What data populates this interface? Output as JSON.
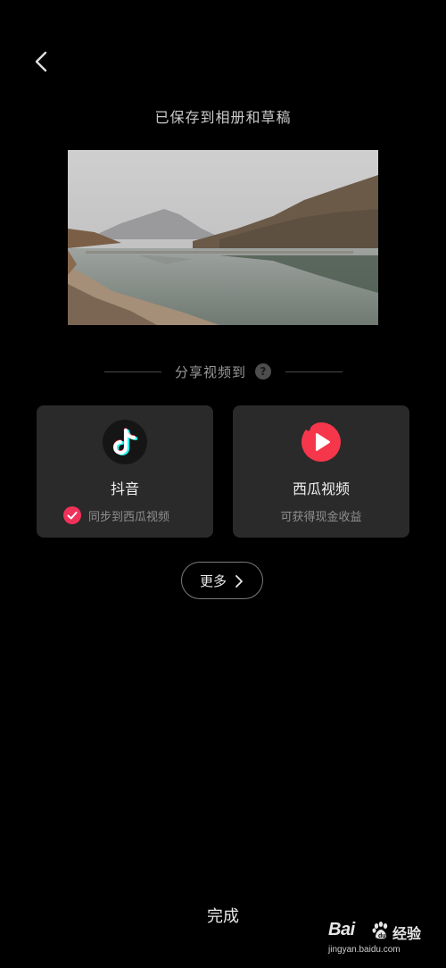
{
  "header": {
    "back_icon": "chevron-left-icon",
    "saved_message": "已保存到相册和草稿"
  },
  "preview": {
    "description_icon": "landscape-thumbnail"
  },
  "share": {
    "label": "分享视频到",
    "help_icon": "question-mark-icon",
    "help_glyph": "?"
  },
  "platforms": {
    "douyin": {
      "name": "抖音",
      "icon": "tiktok-logo-icon",
      "sync_label": "同步到西瓜视频",
      "sync_checked": true,
      "accent": "#f0325a"
    },
    "xigua": {
      "name": "西瓜视频",
      "icon": "xigua-logo-icon",
      "subtitle": "可获得现金收益",
      "accent": "#f5364b"
    }
  },
  "more": {
    "label": "更多",
    "icon": "chevron-right-icon"
  },
  "footer": {
    "done_label": "完成"
  },
  "watermark": {
    "brand": "Bai",
    "brand_tail": "du",
    "cn": "经验",
    "url": "jingyan.baidu.com"
  },
  "colors": {
    "background": "#000000",
    "card": "#2a2a2a",
    "text_muted": "#8f8f8f"
  }
}
